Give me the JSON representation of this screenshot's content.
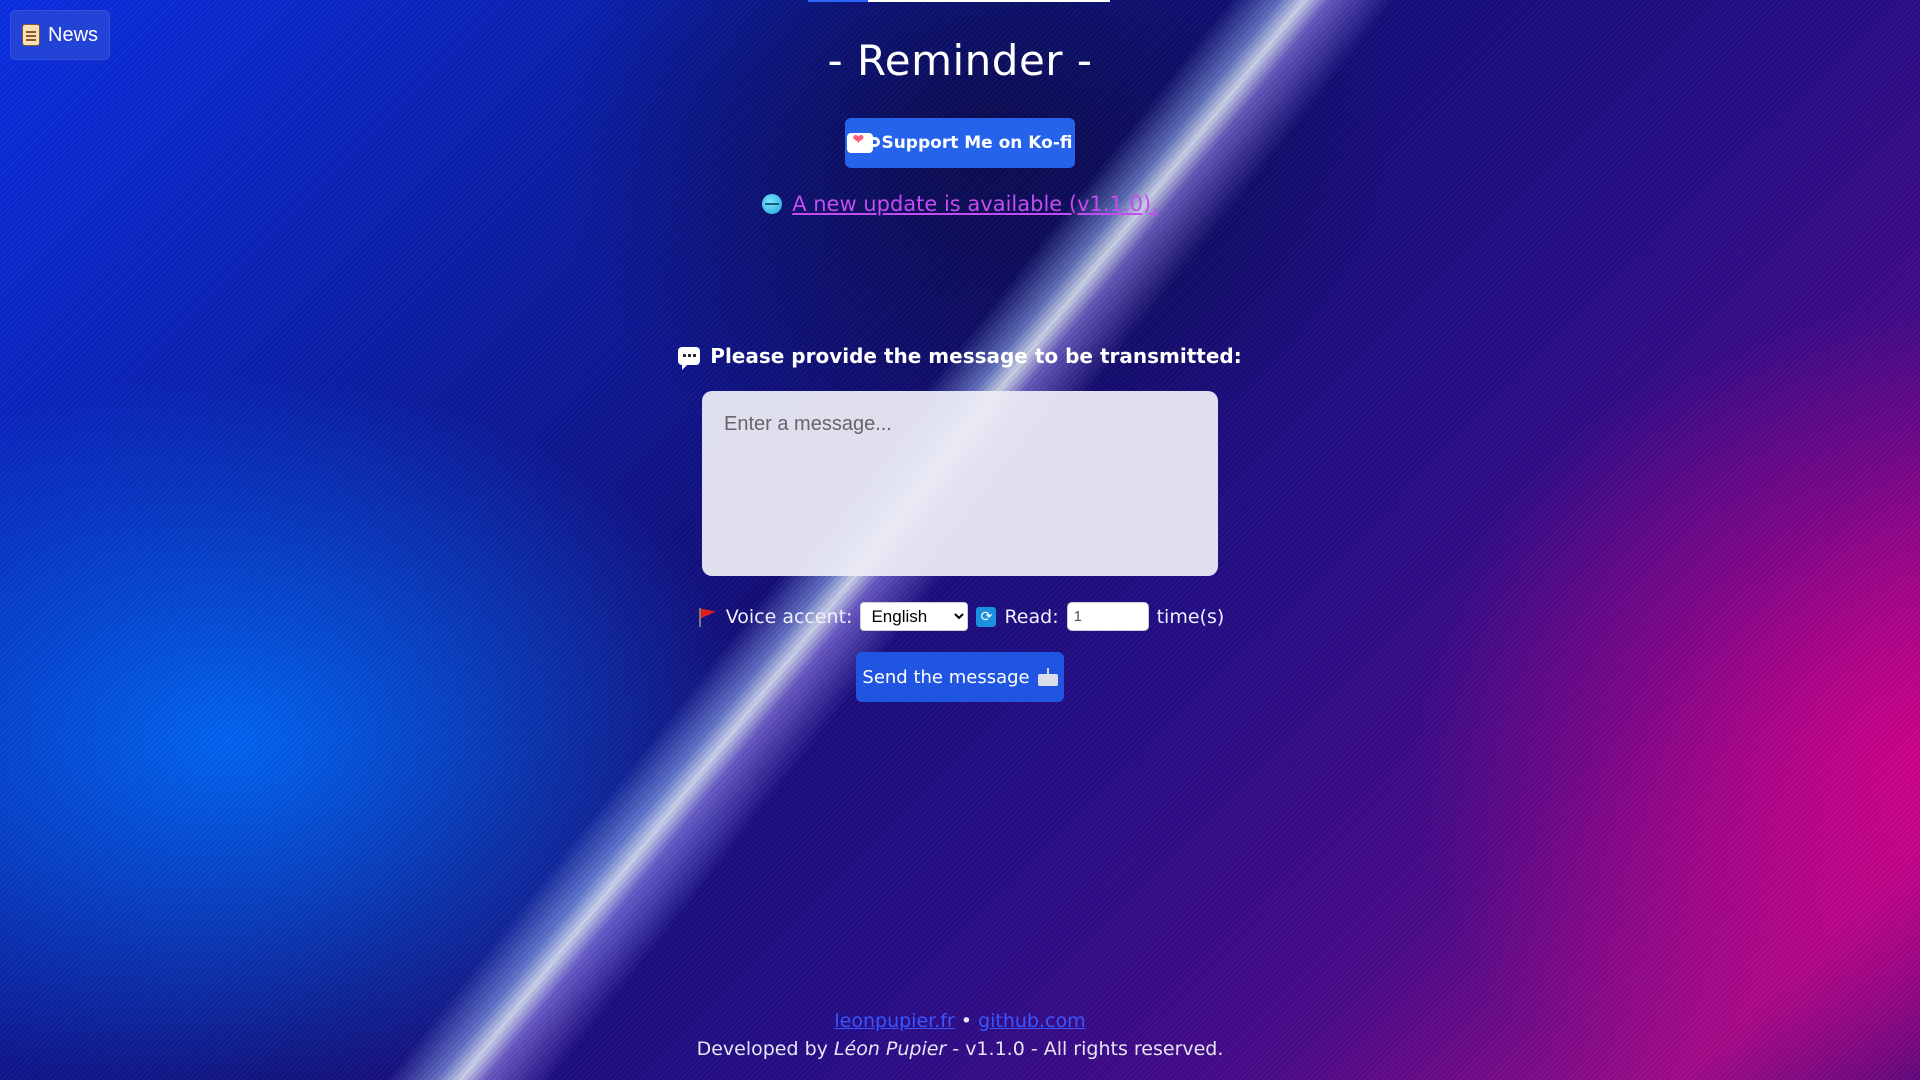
{
  "top_nav": {
    "news_label": "News",
    "news_icon": "scroll-icon"
  },
  "header": {
    "title": "- Reminder -"
  },
  "kofi": {
    "label": "Support Me on Ko-fi",
    "icon": "kofi-cup-icon"
  },
  "update": {
    "icon": "globe-icon",
    "text": "A new update is available (v1.1.0)."
  },
  "form": {
    "prompt": "Please provide the message to be transmitted:",
    "prompt_icon": "speech-bubble-icon",
    "message_placeholder": "Enter a message...",
    "voice_accent_label": "Voice accent:",
    "voice_accent_value": "English",
    "voice_accent_options": [
      "English"
    ],
    "read_label": "Read:",
    "read_value": "1",
    "times_label": "time(s)",
    "send_label": "Send the message"
  },
  "footer": {
    "link1": "leonpupier.fr",
    "separator": "•",
    "link2": "github.com",
    "developed_by": "Developed by",
    "author": "Léon Pupier",
    "rest": "- v1.1.0 - All rights reserved."
  },
  "colors": {
    "button_blue": "#2563eb",
    "update_link": "#c44cf0",
    "footer_link": "#3a56ff"
  }
}
